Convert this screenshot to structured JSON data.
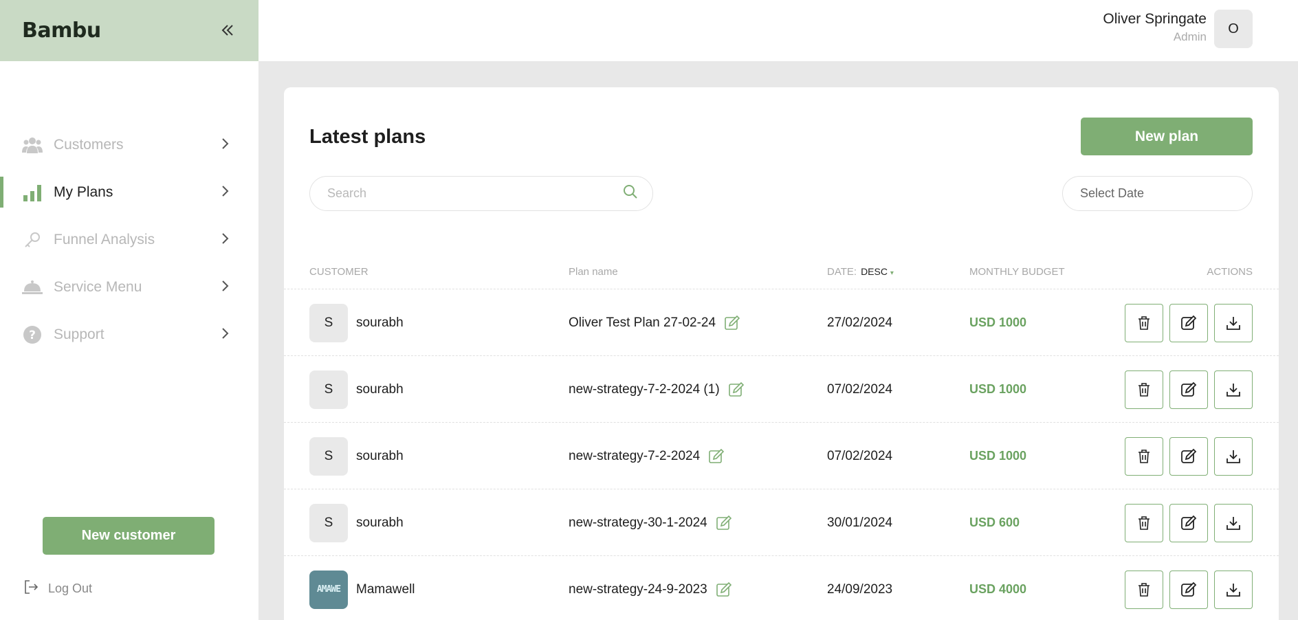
{
  "app": {
    "logo": "Bambu",
    "collapse_icon": "chevrons-left-icon"
  },
  "user": {
    "name": "Oliver Springate",
    "role": "Admin",
    "avatar_initial": "O"
  },
  "sidebar": {
    "items": [
      {
        "label": "Customers",
        "icon": "users-icon",
        "active": false
      },
      {
        "label": "My Plans",
        "icon": "bar-chart-icon",
        "active": true
      },
      {
        "label": "Funnel Analysis",
        "icon": "key-icon",
        "active": false
      },
      {
        "label": "Service Menu",
        "icon": "bell-icon",
        "active": false
      },
      {
        "label": "Support",
        "icon": "help-icon",
        "active": false
      }
    ],
    "new_customer_label": "New customer",
    "logout_label": "Log Out"
  },
  "main": {
    "title": "Latest plans",
    "new_plan_label": "New plan",
    "search_placeholder": "Search",
    "date_select_label": "Select Date",
    "columns": {
      "customer": "CUSTOMER",
      "plan_name": "Plan name",
      "date": "DATE:",
      "date_sort": "DESC",
      "budget": "MONTHLY BUDGET",
      "actions": "ACTIONS"
    },
    "rows": [
      {
        "avatar": "S",
        "customer": "sourabh",
        "plan": "Oliver Test Plan 27-02-24",
        "date": "27/02/2024",
        "budget": "USD 1000"
      },
      {
        "avatar": "S",
        "customer": "sourabh",
        "plan": "new-strategy-7-2-2024 (1)",
        "date": "07/02/2024",
        "budget": "USD 1000"
      },
      {
        "avatar": "S",
        "customer": "sourabh",
        "plan": "new-strategy-7-2-2024",
        "date": "07/02/2024",
        "budget": "USD 1000"
      },
      {
        "avatar": "S",
        "customer": "sourabh",
        "plan": "new-strategy-30-1-2024",
        "date": "30/01/2024",
        "budget": "USD 600"
      },
      {
        "avatar": "AMAWE",
        "customer": "Mamawell",
        "plan": "new-strategy-24-9-2023",
        "date": "24/09/2023",
        "budget": "USD 4000"
      }
    ]
  },
  "colors": {
    "accent": "#7fae74",
    "sidebar_header": "#c9dac5",
    "budget": "#6aa260"
  }
}
